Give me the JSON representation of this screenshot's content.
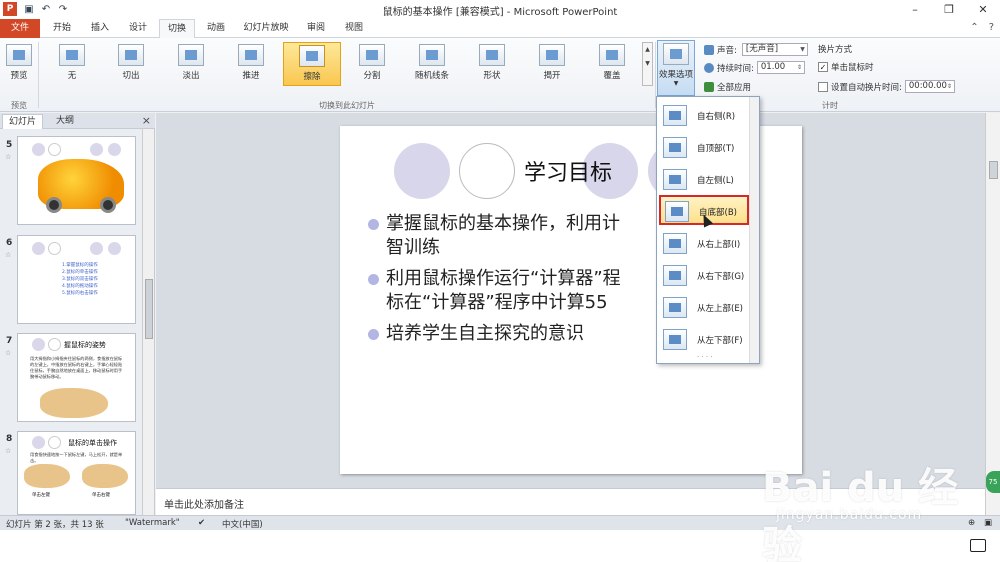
{
  "app": {
    "icon_letter": "P",
    "title": "鼠标的基本操作 [兼容模式] - Microsoft PowerPoint",
    "qat": [
      "save-icon",
      "undo-icon",
      "redo-icon"
    ],
    "window_buttons": [
      "–",
      "❐",
      "✕"
    ]
  },
  "tabs": [
    {
      "label": "文件",
      "kind": "file"
    },
    {
      "label": "开始"
    },
    {
      "label": "插入"
    },
    {
      "label": "设计"
    },
    {
      "label": "切换",
      "active": true
    },
    {
      "label": "动画"
    },
    {
      "label": "幻灯片放映"
    },
    {
      "label": "审阅"
    },
    {
      "label": "视图"
    }
  ],
  "ribbon": {
    "preview": {
      "label": "预览",
      "group": "预览"
    },
    "gallery_group": "切换到此幻灯片",
    "transitions": [
      "无",
      "切出",
      "淡出",
      "推进",
      "擦除",
      "分割",
      "随机线条",
      "形状",
      "揭开",
      "覆盖"
    ],
    "selected_transition": "擦除",
    "effect_options": "效果选项",
    "timing": {
      "sound_label": "声音:",
      "sound_value": "[无声音]",
      "duration_label": "持续时间:",
      "duration_value": "01.00",
      "apply_all": "全部应用",
      "advance_title": "换片方式",
      "on_click": "单击鼠标时",
      "on_click_checked": true,
      "auto_after": "设置自动换片时间:",
      "auto_after_checked": false,
      "auto_value": "00:00.00",
      "group": "计时"
    }
  },
  "leftpanel": {
    "tabs": [
      "幻灯片",
      "大纲"
    ],
    "close": "×",
    "slides": [
      {
        "num": "5",
        "star": "☆"
      },
      {
        "num": "6",
        "star": "☆",
        "lines": [
          "1.掌握鼠标的操作",
          "2.鼠标的单击操作",
          "3.鼠标的双击操作",
          "4.鼠标的拖动操作",
          "5.鼠标的右击操作"
        ]
      },
      {
        "num": "7",
        "star": "☆",
        "title": "握鼠标的姿势",
        "text": "用大拇指和小拇指夹住鼠标的两侧，食指放在鼠标的左键上，中指放在鼠标的右键上，手掌心轻轻贴住鼠标，手腕自然地放在桌面上，移动鼠标时用手腕带动鼠标移动。"
      },
      {
        "num": "8",
        "star": "☆",
        "title": "鼠标的单击操作",
        "text": "用食指快速地按一下鼠标左键，马上松开，就是单击。",
        "caption_left": "单击左键",
        "caption_right": "单击右键"
      }
    ]
  },
  "slide": {
    "title": "学习目标",
    "bullets": [
      [
        "掌握鼠标的基本操作，利用计",
        "智训练"
      ],
      [
        "利用鼠标操作运行“计算器”程",
        "标在“计算器”程序中计算55"
      ],
      [
        "培养学生自主探究的意识"
      ]
    ]
  },
  "notes_placeholder": "单击此处添加备注",
  "status": {
    "slide_info": "幻灯片 第 2 张，共 13 张",
    "theme": "\"Watermark\"",
    "language": "中文(中国)"
  },
  "dropdown": {
    "items": [
      "自右侧(R)",
      "自顶部(T)",
      "自左侧(L)",
      "自底部(B)",
      "从右上部(I)",
      "从右下部(G)",
      "从左上部(E)",
      "从左下部(F)"
    ],
    "highlighted_index": 3
  },
  "watermark": {
    "text": "Bai du 经验",
    "sub": "jingyan.baidu.com",
    "badge": "75"
  }
}
